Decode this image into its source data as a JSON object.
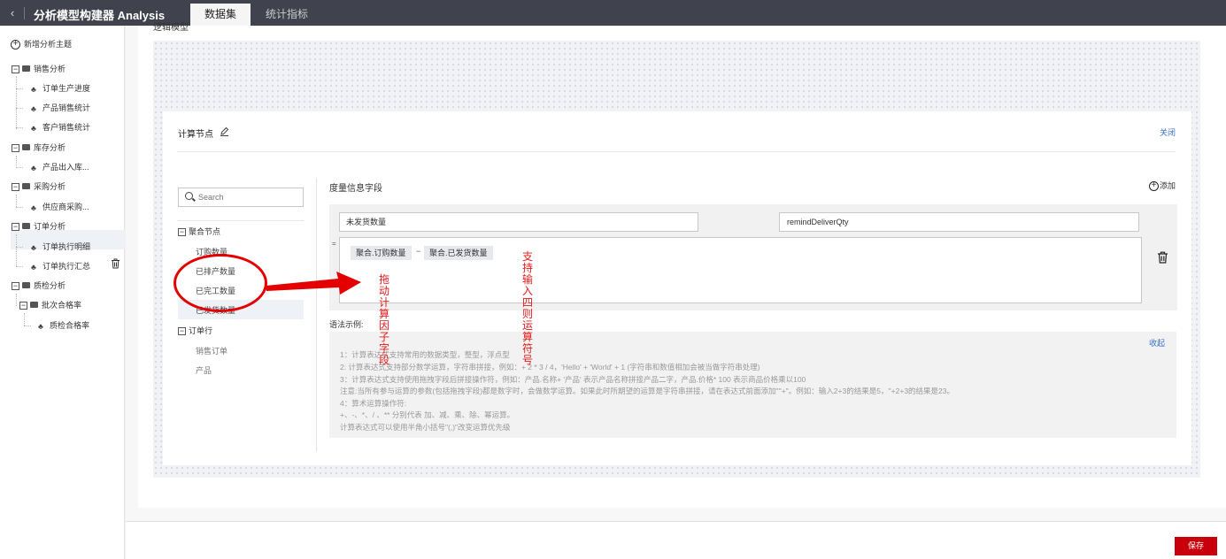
{
  "header": {
    "back_icon": "‹",
    "app_title": "分析模型构建器 Analysis",
    "tabs": [
      {
        "label": "数据集",
        "active": true
      },
      {
        "label": "统计指标",
        "active": false
      }
    ]
  },
  "sidebar": {
    "add_topic_label": "新增分析主题",
    "items": [
      {
        "label": "销售分析",
        "type": "folder"
      },
      {
        "label": "订单生产进度",
        "type": "node"
      },
      {
        "label": "产品销售统计",
        "type": "node"
      },
      {
        "label": "客户销售统计",
        "type": "node"
      },
      {
        "label": "库存分析",
        "type": "folder"
      },
      {
        "label": "产品出入库...",
        "type": "node"
      },
      {
        "label": "采购分析",
        "type": "folder"
      },
      {
        "label": "供应商采购...",
        "type": "node"
      },
      {
        "label": "订单分析",
        "type": "folder"
      },
      {
        "label": "订单执行明细",
        "type": "node"
      },
      {
        "label": "订单执行汇总",
        "type": "node",
        "selected": true
      },
      {
        "label": "质检分析",
        "type": "folder"
      },
      {
        "label": "批次合格率",
        "type": "folder"
      },
      {
        "label": "质检合格率",
        "type": "node"
      }
    ]
  },
  "canvas": {
    "title": "逻辑模型"
  },
  "calc_node": {
    "title": "计算节点",
    "close_label": "关闭",
    "search_placeholder": "Search",
    "groups": [
      {
        "label": "聚合节点",
        "fields": [
          "订购数量",
          "已排产数量",
          "已完工数量",
          "已发货数量"
        ]
      },
      {
        "label": "订单行",
        "fields": [
          "销售订单",
          "产品"
        ]
      }
    ],
    "measure_title": "度量信息字段",
    "add_label": "添加",
    "field_name": "未发货数量",
    "field_code": "remindDeliverQty",
    "eq_sign": "=",
    "expression": {
      "left_chip": "聚合.订购数量",
      "operator": "−",
      "right_chip": "聚合.已发货数量"
    },
    "syntax_label": "语法示例:",
    "collapse_label": "收起",
    "syntax_lines": [
      "1：计算表达式支持常用的数据类型，整型，浮点型",
      "2: 计算表达式支持部分数学运算，字符串拼接，例如：+ 2 * 3 / 4，'Hello' + 'World' + 1 (字符串和数值相加会被当做字符串处理)",
      "3：计算表达式支持使用拖拽字段后拼接操作符，例如：产品.名称+ '产品' 表示产品名称拼接产品二字，产品.价格* 100 表示商品价格乘以100",
      "注意:当所有参与运算的参数(包括拖拽字段)都是数字时，会做数学运算。如果此时所期望的运算是字符串拼接，请在表达式前面添加\"''+\"。例如：输入2+3的结果是5，''+2+3的结果是23。",
      "4：算术运算操作符:",
      "+、-、*、/ 、** 分别代表 加、减、乘、除、幂运算。",
      "计算表达式可以使用半角小括号\"(,)\"改变运算优先级"
    ]
  },
  "annotations": {
    "drag_hint": "拖动计算因子字段",
    "operator_hint": "支持输入四则运算符号",
    "color": "#e40000"
  },
  "footer": {
    "save_label": "保存"
  },
  "colors": {
    "topbar": "#40434d",
    "accent_link": "#3a6fc9",
    "save_button": "#c7000b"
  }
}
